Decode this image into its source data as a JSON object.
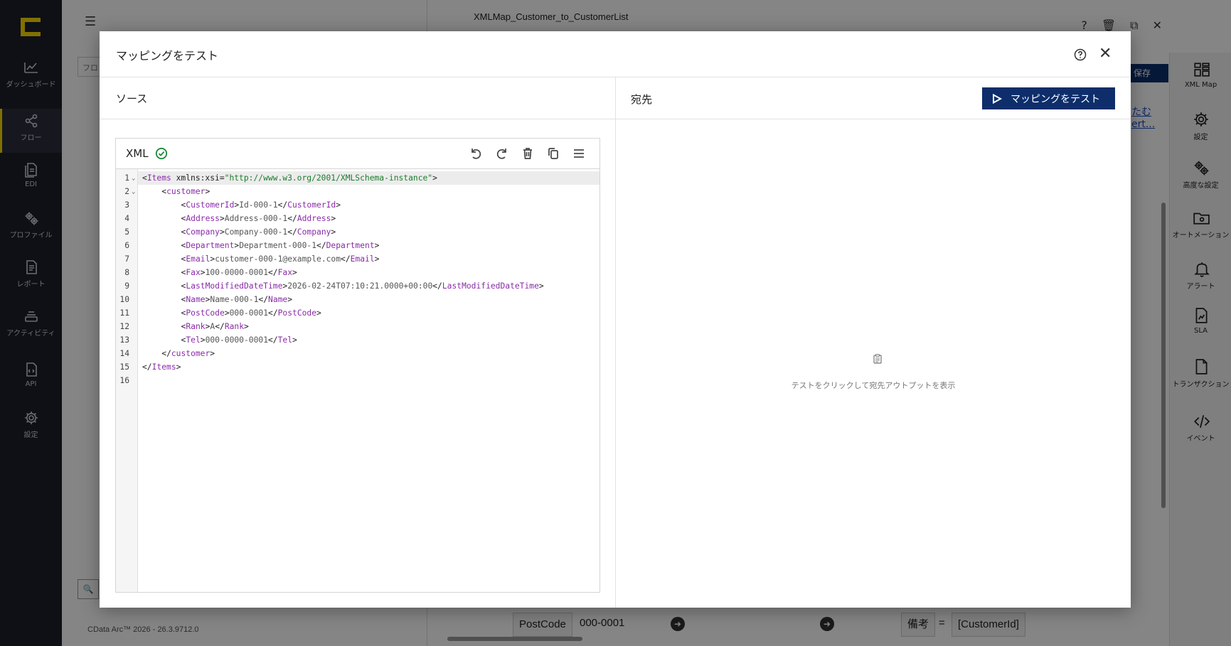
{
  "app": {
    "nav": [
      {
        "label": "ダッシュボード",
        "icon": "chart-icon"
      },
      {
        "label": "フロー",
        "icon": "share-icon"
      },
      {
        "label": "EDI",
        "icon": "document-icon"
      },
      {
        "label": "プロファイル",
        "icon": "gears-icon"
      },
      {
        "label": "レポート",
        "icon": "report-icon"
      },
      {
        "label": "アクティビティ",
        "icon": "stack-icon"
      },
      {
        "label": "API",
        "icon": "file-code-icon"
      },
      {
        "label": "設定",
        "icon": "gear-icon"
      }
    ],
    "search_placeholder": "フロ",
    "footer": "CData Arc™ 2026 - 26.3.9712.0",
    "flow_title": "XMLMap_Customer_to_CustomerList",
    "save_label": "保存",
    "links": [
      "たむ",
      "ert..."
    ],
    "canvas_node": {
      "name": "PostCode",
      "value": "000-0001"
    },
    "canvas_target": {
      "name": "備考",
      "op": "=",
      "value": "[CustomerId]"
    },
    "right_nav": [
      {
        "label": "XML Map",
        "icon": "grid-icon"
      },
      {
        "label": "設定",
        "icon": "gear-icon"
      },
      {
        "label": "高度な設定",
        "icon": "gears-icon"
      },
      {
        "label": "オートメーション",
        "icon": "folder-gear-icon"
      },
      {
        "label": "アラート",
        "icon": "bell-icon"
      },
      {
        "label": "SLA",
        "icon": "file-chart-icon"
      },
      {
        "label": "トランザクション",
        "icon": "file-icon"
      },
      {
        "label": "イベント",
        "icon": "code-icon"
      }
    ]
  },
  "modal": {
    "title": "マッピングをテスト",
    "source_label": "ソース",
    "dest_label": "宛先",
    "test_button": "マッピングをテスト",
    "editor_format": "XML",
    "empty_message": "テストをクリックして宛先アウトプットを表示",
    "code_lines": [
      {
        "n": "1",
        "fold": true,
        "indent": 0,
        "parts": [
          [
            "p",
            "<"
          ],
          [
            "t",
            "Items"
          ],
          [
            "a",
            " xmlns:xsi"
          ],
          [
            "p",
            "="
          ],
          [
            "s",
            "\"http://www.w3.org/2001/XMLSchema-instance\""
          ],
          [
            "p",
            ">"
          ]
        ]
      },
      {
        "n": "2",
        "fold": true,
        "indent": 4,
        "parts": [
          [
            "p",
            "<"
          ],
          [
            "t",
            "customer"
          ],
          [
            "p",
            ">"
          ]
        ]
      },
      {
        "n": "3",
        "fold": false,
        "indent": 8,
        "parts": [
          [
            "p",
            "<"
          ],
          [
            "t",
            "CustomerId"
          ],
          [
            "p",
            ">"
          ],
          [
            "v",
            "Id-000-1"
          ],
          [
            "p",
            "</"
          ],
          [
            "t",
            "CustomerId"
          ],
          [
            "p",
            ">"
          ]
        ]
      },
      {
        "n": "4",
        "fold": false,
        "indent": 8,
        "parts": [
          [
            "p",
            "<"
          ],
          [
            "t",
            "Address"
          ],
          [
            "p",
            ">"
          ],
          [
            "v",
            "Address-000-1"
          ],
          [
            "p",
            "</"
          ],
          [
            "t",
            "Address"
          ],
          [
            "p",
            ">"
          ]
        ]
      },
      {
        "n": "5",
        "fold": false,
        "indent": 8,
        "parts": [
          [
            "p",
            "<"
          ],
          [
            "t",
            "Company"
          ],
          [
            "p",
            ">"
          ],
          [
            "v",
            "Company-000-1"
          ],
          [
            "p",
            "</"
          ],
          [
            "t",
            "Company"
          ],
          [
            "p",
            ">"
          ]
        ]
      },
      {
        "n": "6",
        "fold": false,
        "indent": 8,
        "parts": [
          [
            "p",
            "<"
          ],
          [
            "t",
            "Department"
          ],
          [
            "p",
            ">"
          ],
          [
            "v",
            "Department-000-1"
          ],
          [
            "p",
            "</"
          ],
          [
            "t",
            "Department"
          ],
          [
            "p",
            ">"
          ]
        ]
      },
      {
        "n": "7",
        "fold": false,
        "indent": 8,
        "parts": [
          [
            "p",
            "<"
          ],
          [
            "t",
            "Email"
          ],
          [
            "p",
            ">"
          ],
          [
            "v",
            "customer-000-1@example.com"
          ],
          [
            "p",
            "</"
          ],
          [
            "t",
            "Email"
          ],
          [
            "p",
            ">"
          ]
        ]
      },
      {
        "n": "8",
        "fold": false,
        "indent": 8,
        "parts": [
          [
            "p",
            "<"
          ],
          [
            "t",
            "Fax"
          ],
          [
            "p",
            ">"
          ],
          [
            "v",
            "100-0000-0001"
          ],
          [
            "p",
            "</"
          ],
          [
            "t",
            "Fax"
          ],
          [
            "p",
            ">"
          ]
        ]
      },
      {
        "n": "9",
        "fold": false,
        "indent": 8,
        "parts": [
          [
            "p",
            "<"
          ],
          [
            "t",
            "LastModifiedDateTime"
          ],
          [
            "p",
            ">"
          ],
          [
            "v",
            "2026-02-24T07:10:21.0000+00:00"
          ],
          [
            "p",
            "</"
          ],
          [
            "t",
            "LastModifiedDateTime"
          ],
          [
            "p",
            ">"
          ]
        ]
      },
      {
        "n": "10",
        "fold": false,
        "indent": 8,
        "parts": [
          [
            "p",
            "<"
          ],
          [
            "t",
            "Name"
          ],
          [
            "p",
            ">"
          ],
          [
            "v",
            "Name-000-1"
          ],
          [
            "p",
            "</"
          ],
          [
            "t",
            "Name"
          ],
          [
            "p",
            ">"
          ]
        ]
      },
      {
        "n": "11",
        "fold": false,
        "indent": 8,
        "parts": [
          [
            "p",
            "<"
          ],
          [
            "t",
            "PostCode"
          ],
          [
            "p",
            ">"
          ],
          [
            "v",
            "000-0001"
          ],
          [
            "p",
            "</"
          ],
          [
            "t",
            "PostCode"
          ],
          [
            "p",
            ">"
          ]
        ]
      },
      {
        "n": "12",
        "fold": false,
        "indent": 8,
        "parts": [
          [
            "p",
            "<"
          ],
          [
            "t",
            "Rank"
          ],
          [
            "p",
            ">"
          ],
          [
            "v",
            "A"
          ],
          [
            "p",
            "</"
          ],
          [
            "t",
            "Rank"
          ],
          [
            "p",
            ">"
          ]
        ]
      },
      {
        "n": "13",
        "fold": false,
        "indent": 8,
        "parts": [
          [
            "p",
            "<"
          ],
          [
            "t",
            "Tel"
          ],
          [
            "p",
            ">"
          ],
          [
            "v",
            "000-0000-0001"
          ],
          [
            "p",
            "</"
          ],
          [
            "t",
            "Tel"
          ],
          [
            "p",
            ">"
          ]
        ]
      },
      {
        "n": "14",
        "fold": false,
        "indent": 4,
        "parts": [
          [
            "p",
            "</"
          ],
          [
            "t",
            "customer"
          ],
          [
            "p",
            ">"
          ]
        ]
      },
      {
        "n": "15",
        "fold": false,
        "indent": 0,
        "parts": [
          [
            "p",
            "</"
          ],
          [
            "t",
            "Items"
          ],
          [
            "p",
            ">"
          ]
        ]
      },
      {
        "n": "16",
        "fold": false,
        "indent": 0,
        "parts": []
      }
    ]
  },
  "colors": {
    "primary": "#0d2e6b",
    "brand_accent": "#f5d800",
    "valid_green": "#1a8a3a",
    "xml_tag": "#8a2ba8",
    "xml_string": "#1a7d2a"
  }
}
